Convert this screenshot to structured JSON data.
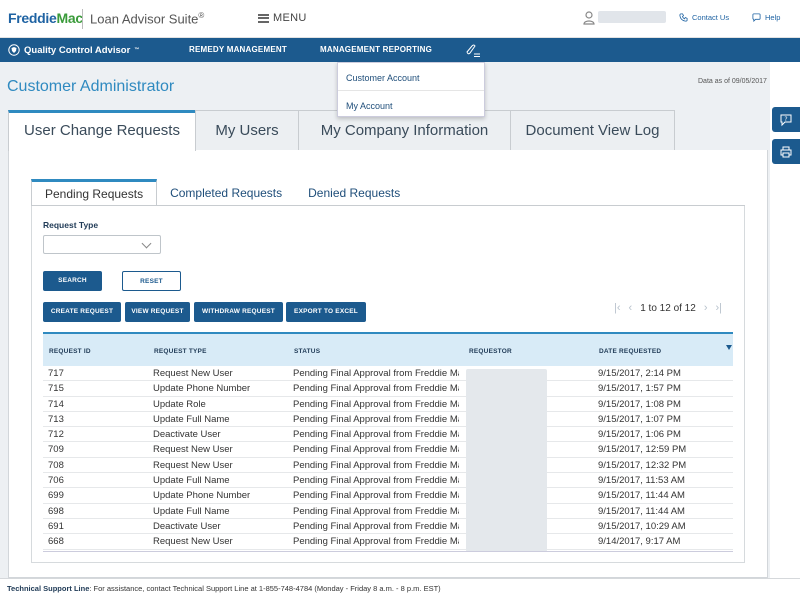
{
  "header": {
    "logo_part1": "Freddie",
    "logo_part2": "Mac",
    "suite": "Loan Advisor Suite",
    "suite_mark": "®",
    "menu_label": "MENU",
    "contact_label": "Contact Us",
    "help_label": "Help"
  },
  "navbar": {
    "app_name": "Quality Control Advisor",
    "app_mark": "™",
    "items": [
      "REMEDY MANAGEMENT",
      "MANAGEMENT REPORTING"
    ]
  },
  "dropdown": {
    "items": [
      "Customer Account",
      "My Account"
    ]
  },
  "page": {
    "title": "Customer Administrator",
    "data_as_of": "Data as of 09/05/2017"
  },
  "main_tabs": [
    "User Change Requests",
    "My Users",
    "My Company Information",
    "Document View Log"
  ],
  "sub_tabs": [
    "Pending Requests",
    "Completed Requests",
    "Denied Requests"
  ],
  "filter": {
    "request_type_label": "Request Type",
    "request_type_value": "",
    "search_label": "SEARCH",
    "reset_label": "RESET"
  },
  "actions": [
    "CREATE REQUEST",
    "VIEW REQUEST",
    "WITHDRAW REQUEST",
    "EXPORT TO EXCEL"
  ],
  "pager": {
    "text": "1 to 12 of 12"
  },
  "table": {
    "columns": [
      "REQUEST ID",
      "REQUEST TYPE",
      "STATUS",
      "REQUESTOR",
      "DATE REQUESTED"
    ],
    "rows": [
      {
        "id": "717",
        "type": "Request New User",
        "status": "Pending Final Approval from Freddie Mac",
        "date": "9/15/2017, 2:14 PM"
      },
      {
        "id": "715",
        "type": "Update Phone Number",
        "status": "Pending Final Approval from Freddie Mac",
        "date": "9/15/2017, 1:57 PM"
      },
      {
        "id": "714",
        "type": "Update Role",
        "status": "Pending Final Approval from Freddie Mac",
        "date": "9/15/2017, 1:08 PM"
      },
      {
        "id": "713",
        "type": "Update Full Name",
        "status": "Pending Final Approval from Freddie Mac",
        "date": "9/15/2017, 1:07 PM"
      },
      {
        "id": "712",
        "type": "Deactivate User",
        "status": "Pending Final Approval from Freddie Mac",
        "date": "9/15/2017, 1:06 PM"
      },
      {
        "id": "709",
        "type": "Request New User",
        "status": "Pending Final Approval from Freddie Mac",
        "date": "9/15/2017, 12:59 PM"
      },
      {
        "id": "708",
        "type": "Request New User",
        "status": "Pending Final Approval from Freddie Mac",
        "date": "9/15/2017, 12:32 PM"
      },
      {
        "id": "706",
        "type": "Update Full Name",
        "status": "Pending Final Approval from Freddie Mac",
        "date": "9/15/2017, 11:53 AM"
      },
      {
        "id": "699",
        "type": "Update Phone Number",
        "status": "Pending Final Approval from Freddie Mac",
        "date": "9/15/2017, 11:44 AM"
      },
      {
        "id": "698",
        "type": "Update Full Name",
        "status": "Pending Final Approval from Freddie Mac",
        "date": "9/15/2017, 11:44 AM"
      },
      {
        "id": "691",
        "type": "Deactivate User",
        "status": "Pending Final Approval from Freddie Mac",
        "date": "9/15/2017, 10:29 AM"
      },
      {
        "id": "668",
        "type": "Request New User",
        "status": "Pending Final Approval from Freddie Mac",
        "date": "9/14/2017, 9:17 AM"
      }
    ]
  },
  "footer": {
    "label": "Technical Support Line",
    "text": ": For assistance, contact Technical Support Line at 1-855-748-4784 (Monday - Friday 8 a.m. - 8 p.m. EST)"
  },
  "colors": {
    "brand_blue": "#1c5a8e",
    "accent_blue": "#2f8ac0",
    "logo_green": "#3a9b3a"
  }
}
